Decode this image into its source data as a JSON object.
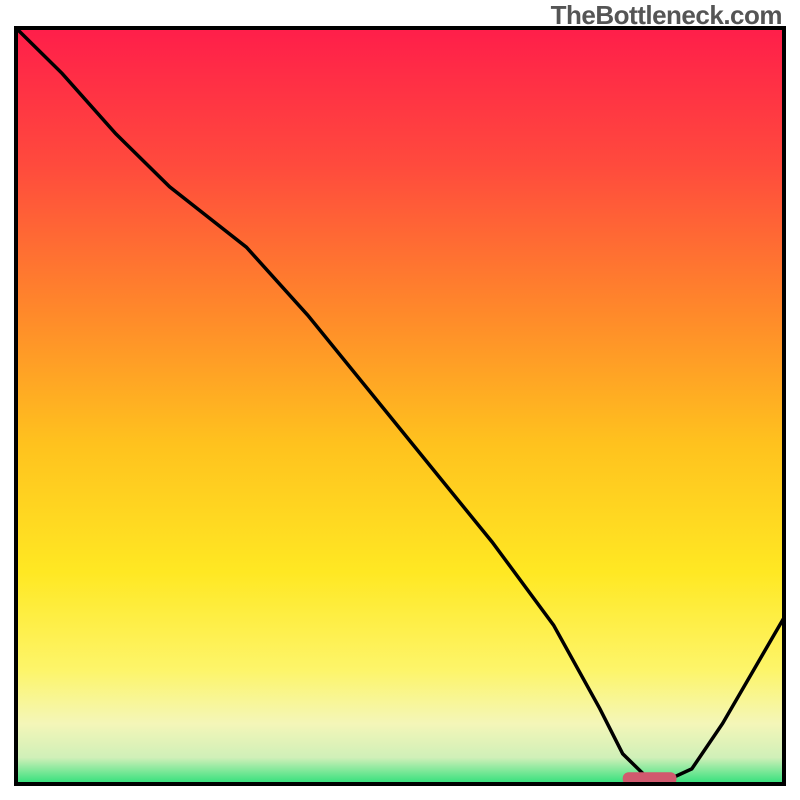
{
  "watermark": "TheBottleneck.com",
  "chart_data": {
    "type": "line",
    "title": "",
    "xlabel": "",
    "ylabel": "",
    "x_range": [
      0,
      100
    ],
    "y_range": [
      0,
      100
    ],
    "series": [
      {
        "name": "bottleneck-curve",
        "x": [
          0,
          6,
          13,
          20,
          25,
          30,
          38,
          46,
          54,
          62,
          70,
          76,
          79,
          82,
          85,
          88,
          92,
          96,
          100
        ],
        "y": [
          100,
          94,
          86,
          79,
          75,
          71,
          62,
          52,
          42,
          32,
          21,
          10,
          4,
          1,
          0.6,
          2,
          8,
          15,
          22
        ]
      }
    ],
    "marker": {
      "x_min": 79,
      "x_max": 86,
      "y": 0.7
    },
    "gradient_stops": [
      {
        "pos": 0.0,
        "color": "#ff1e4a"
      },
      {
        "pos": 0.18,
        "color": "#ff4a3d"
      },
      {
        "pos": 0.38,
        "color": "#ff8a2a"
      },
      {
        "pos": 0.55,
        "color": "#ffc21e"
      },
      {
        "pos": 0.72,
        "color": "#ffe823"
      },
      {
        "pos": 0.85,
        "color": "#fdf56a"
      },
      {
        "pos": 0.92,
        "color": "#f4f6b8"
      },
      {
        "pos": 0.965,
        "color": "#d0f0b8"
      },
      {
        "pos": 1.0,
        "color": "#2ee07a"
      }
    ]
  }
}
